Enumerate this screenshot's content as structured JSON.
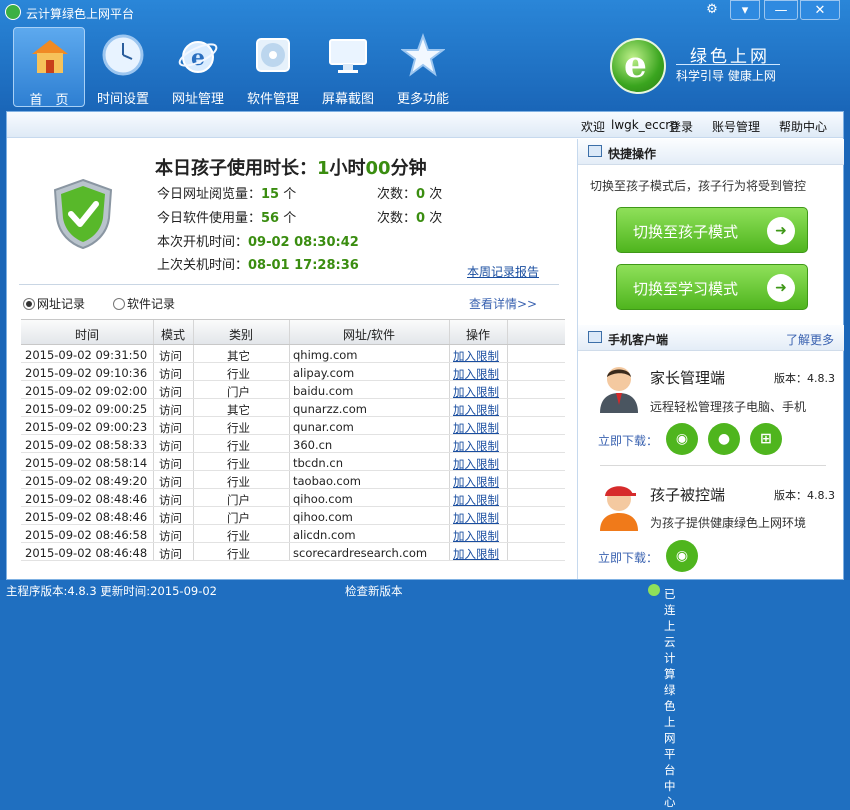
{
  "window": {
    "title": "云计算绿色上网平台"
  },
  "toolbar": [
    {
      "label": "首　页",
      "icon": "home-icon"
    },
    {
      "label": "时间设置",
      "icon": "clock-icon"
    },
    {
      "label": "网址管理",
      "icon": "internet-explorer-icon"
    },
    {
      "label": "软件管理",
      "icon": "disc-icon"
    },
    {
      "label": "屏幕截图",
      "icon": "monitor-icon"
    },
    {
      "label": "更多功能",
      "icon": "star-icon"
    }
  ],
  "logo": {
    "title": "绿色上网",
    "subtitle": "科学引导 健康上网"
  },
  "userbar": {
    "welcome": "欢迎",
    "username": "lwgk_eccrp",
    "login": "登录",
    "account": "账号管理",
    "help": "帮助中心"
  },
  "summary": {
    "usage_label": "本日孩子使用时长：",
    "hours": "1",
    "hours_unit": "小时",
    "minutes": "00",
    "minutes_unit": "分钟",
    "web_label": "今日网址阅览量：",
    "web_count": "15",
    "web_unit": "个",
    "web_times_label": "次数：",
    "web_times": "0",
    "web_times_unit": "次",
    "soft_label": "今日软件使用量：",
    "soft_count": "56",
    "soft_unit": "个",
    "soft_times_label": "次数：",
    "soft_times": "0",
    "soft_times_unit": "次",
    "boot_label": "本次开机时间：",
    "boot_time": "09-02 08:30:42",
    "shutdown_label": "上次关机时间：",
    "shutdown_time": "08-01 17:28:36",
    "weekly_report": "本周记录报告"
  },
  "records": {
    "tab_web": "网址记录",
    "tab_soft": "软件记录",
    "view_more": "查看详情>>",
    "columns": [
      "时间",
      "模式",
      "类别",
      "网址/软件",
      "操作"
    ],
    "rows": [
      {
        "time": "2015-09-02 09:31:50",
        "mode": "访问",
        "category": "其它",
        "target": "qhimg.com",
        "action": "加入限制"
      },
      {
        "time": "2015-09-02 09:10:36",
        "mode": "访问",
        "category": "行业",
        "target": "alipay.com",
        "action": "加入限制"
      },
      {
        "time": "2015-09-02 09:02:00",
        "mode": "访问",
        "category": "门户",
        "target": "baidu.com",
        "action": "加入限制"
      },
      {
        "time": "2015-09-02 09:00:25",
        "mode": "访问",
        "category": "其它",
        "target": "qunarzz.com",
        "action": "加入限制"
      },
      {
        "time": "2015-09-02 09:00:23",
        "mode": "访问",
        "category": "行业",
        "target": "qunar.com",
        "action": "加入限制"
      },
      {
        "time": "2015-09-02 08:58:33",
        "mode": "访问",
        "category": "行业",
        "target": "360.cn",
        "action": "加入限制"
      },
      {
        "time": "2015-09-02 08:58:14",
        "mode": "访问",
        "category": "行业",
        "target": "tbcdn.cn",
        "action": "加入限制"
      },
      {
        "time": "2015-09-02 08:49:20",
        "mode": "访问",
        "category": "行业",
        "target": "taobao.com",
        "action": "加入限制"
      },
      {
        "time": "2015-09-02 08:48:46",
        "mode": "访问",
        "category": "门户",
        "target": "qihoo.com",
        "action": "加入限制"
      },
      {
        "time": "2015-09-02 08:48:46",
        "mode": "访问",
        "category": "门户",
        "target": "qihoo.com",
        "action": "加入限制"
      },
      {
        "time": "2015-09-02 08:46:58",
        "mode": "访问",
        "category": "行业",
        "target": "alicdn.com",
        "action": "加入限制"
      },
      {
        "time": "2015-09-02 08:46:48",
        "mode": "访问",
        "category": "行业",
        "target": "scorecardresearch.com",
        "action": "加入限制"
      }
    ]
  },
  "quick": {
    "title": "快捷操作",
    "note": "切换至孩子模式后，孩子行为将受到管控",
    "child_mode": "切换至孩子模式",
    "study_mode": "切换至学习模式"
  },
  "mobile": {
    "title": "手机客户端",
    "learn_more": "了解更多",
    "parent": {
      "name": "家长管理端",
      "version": "版本：4.8.3",
      "desc": "远程轻松管理孩子电脑、手机",
      "download": "立即下载："
    },
    "child": {
      "name": "孩子被控端",
      "version": "版本：4.8.3",
      "desc": "为孩子提供健康绿色上网环境",
      "download": "立即下载："
    }
  },
  "status": {
    "version": "主程序版本:4.8.3  更新时间:2015-09-02",
    "check": "检查新版本",
    "connected": "已连上云计算绿色上网平台中心"
  }
}
